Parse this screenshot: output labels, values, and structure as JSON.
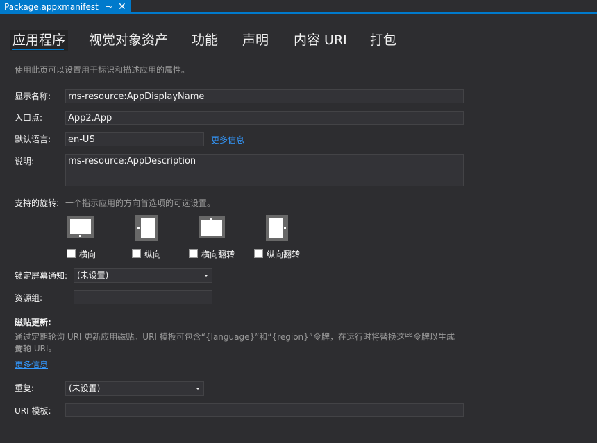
{
  "document_tab": {
    "title": "Package.appxmanifest",
    "pin_glyph": "⊸",
    "close_glyph": "✕"
  },
  "tabs": [
    {
      "label": "应用程序"
    },
    {
      "label": "视觉对象资产"
    },
    {
      "label": "功能"
    },
    {
      "label": "声明"
    },
    {
      "label": "内容 URI"
    },
    {
      "label": "打包"
    }
  ],
  "description": "使用此页可以设置用于标识和描述应用的属性。",
  "fields": {
    "display_name": {
      "label": "显示名称:",
      "value": "ms-resource:AppDisplayName"
    },
    "entry_point": {
      "label": "入口点:",
      "value": "App2.App"
    },
    "default_language": {
      "label": "默认语言:",
      "value": "en-US",
      "more_info": "更多信息"
    },
    "description_field": {
      "label": "说明:",
      "value": "ms-resource:AppDescription"
    }
  },
  "rotation": {
    "label": "支持的旋转:",
    "hint": "一个指示应用的方向首选项的可选设置。",
    "options": [
      {
        "label": "横向",
        "checked": false
      },
      {
        "label": "纵向",
        "checked": false
      },
      {
        "label": "横向翻转",
        "checked": false
      },
      {
        "label": "纵向翻转",
        "checked": false
      }
    ]
  },
  "lock_screen": {
    "label": "锁定屏幕通知:",
    "value": "(未设置)"
  },
  "resource_group": {
    "label": "资源组:",
    "value": ""
  },
  "tile_update": {
    "title": "磁贴更新:",
    "paragraph_line1": "通过定期轮询 URI 更新应用磁贴。URI 模板可包含“{language}”和“{region}”令牌，在运行时将替换这些令牌以生成要轮",
    "paragraph_line2": "询的 URI。",
    "more_info": "更多信息",
    "recurrence": {
      "label": "重复:",
      "value": "(未设置)"
    },
    "uri_template": {
      "label": "URI 模板:",
      "value": ""
    }
  },
  "colors": {
    "accent": "#007acc",
    "background": "#2d2d30",
    "link": "#3399ff"
  }
}
